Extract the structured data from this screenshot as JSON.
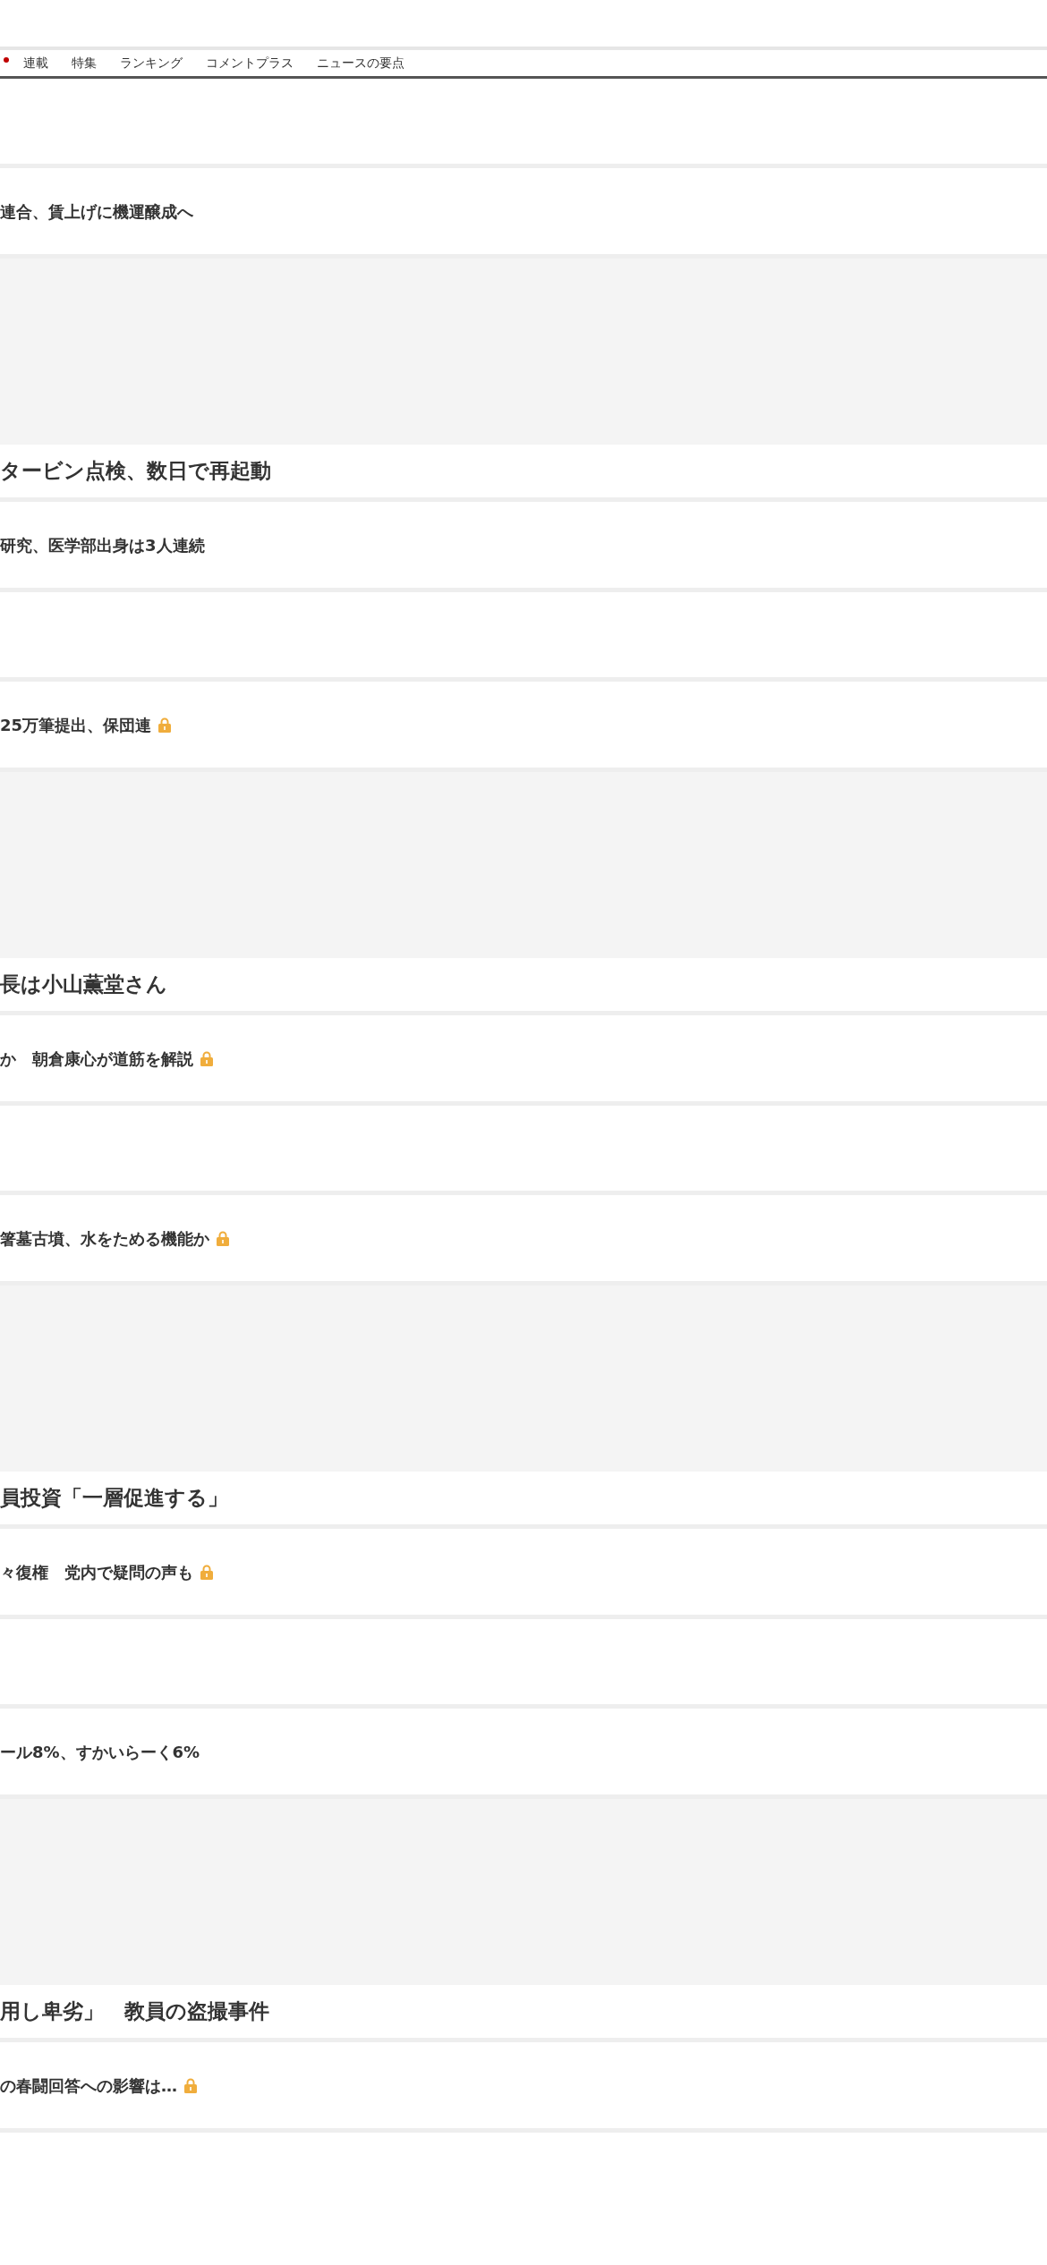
{
  "nav": {
    "items": [
      "連載",
      "特集",
      "ランキング",
      "コメントプラス",
      "ニュースの要点"
    ]
  },
  "feed": [
    {
      "kind": "blank"
    },
    {
      "kind": "text",
      "headline": "連合、賃上げに機運醸成へ",
      "locked": false
    },
    {
      "kind": "photo",
      "headline": "タービン点検、数日で再起動"
    },
    {
      "kind": "text",
      "headline": "研究、医学部出身は3人連続",
      "locked": false
    },
    {
      "kind": "blank"
    },
    {
      "kind": "text",
      "headline": "25万筆提出、保団連",
      "locked": true
    },
    {
      "kind": "photo",
      "headline": "長は小山薫堂さん"
    },
    {
      "kind": "text",
      "headline": "か　朝倉康心が道筋を解説",
      "locked": true
    },
    {
      "kind": "blank"
    },
    {
      "kind": "text",
      "headline": "箸墓古墳、水をためる機能か",
      "locked": true
    },
    {
      "kind": "photo",
      "headline": "員投資「一層促進する」"
    },
    {
      "kind": "text",
      "headline": "々復権　党内で疑問の声も",
      "locked": true
    },
    {
      "kind": "blank"
    },
    {
      "kind": "text",
      "headline": "ール8%、すかいらーく6%",
      "locked": false
    },
    {
      "kind": "photo",
      "headline": "用し卑劣」　教員の盗撮事件"
    },
    {
      "kind": "text",
      "headline": "の春闘回答への影響は…",
      "locked": true
    }
  ]
}
